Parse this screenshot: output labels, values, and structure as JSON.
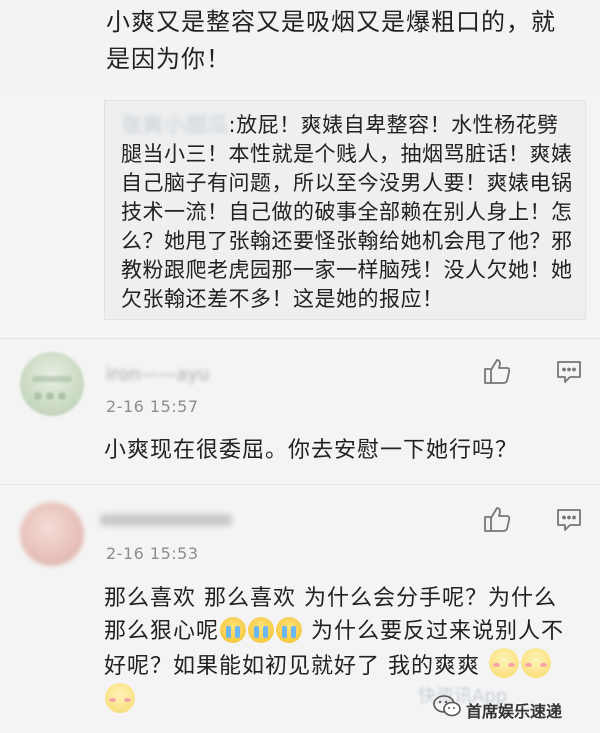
{
  "top_comment": {
    "text": "小爽又是整容又是吸烟又是爆粗口的，就是因为你！"
  },
  "quote": {
    "author": "张爽小甜瓜",
    "text": ":放屁！爽婊自卑整容！水性杨花劈腿当小三！本性就是个贱人，抽烟骂脏话！爽婊自己脑子有问题，所以至今没男人要！爽婊电锅技术一流！自己做的破事全部赖在别人身上！怎么？她甩了张翰还要怪张翰给她机会甩了他？邪教粉跟爬老虎园那一家一样脑残！没人欠她！她欠张翰还差不多！这是她的报应！"
  },
  "comments": [
    {
      "username": "iron——ayu",
      "timestamp": "2-16 15:57",
      "text": "小爽现在很委屈。你去安慰一下她行吗？"
    },
    {
      "username": "",
      "timestamp": "2-16 15:53",
      "text_a": "那么喜欢 那么喜欢 为什么会分手呢？为什么那么狠心呢",
      "text_b": " 为什么要反过来说别人不好呢？如果能如初见就好了 我的爽爽"
    }
  ],
  "icons": {
    "like": "thumbs-up-icon",
    "reply": "comment-bubble-icon",
    "cry": "crying-face-emoji",
    "blush": "blushing-face-emoji",
    "wechat": "wechat-icon"
  },
  "watermark": {
    "faint": "快资讯App",
    "brand": "首席娱乐速递"
  }
}
